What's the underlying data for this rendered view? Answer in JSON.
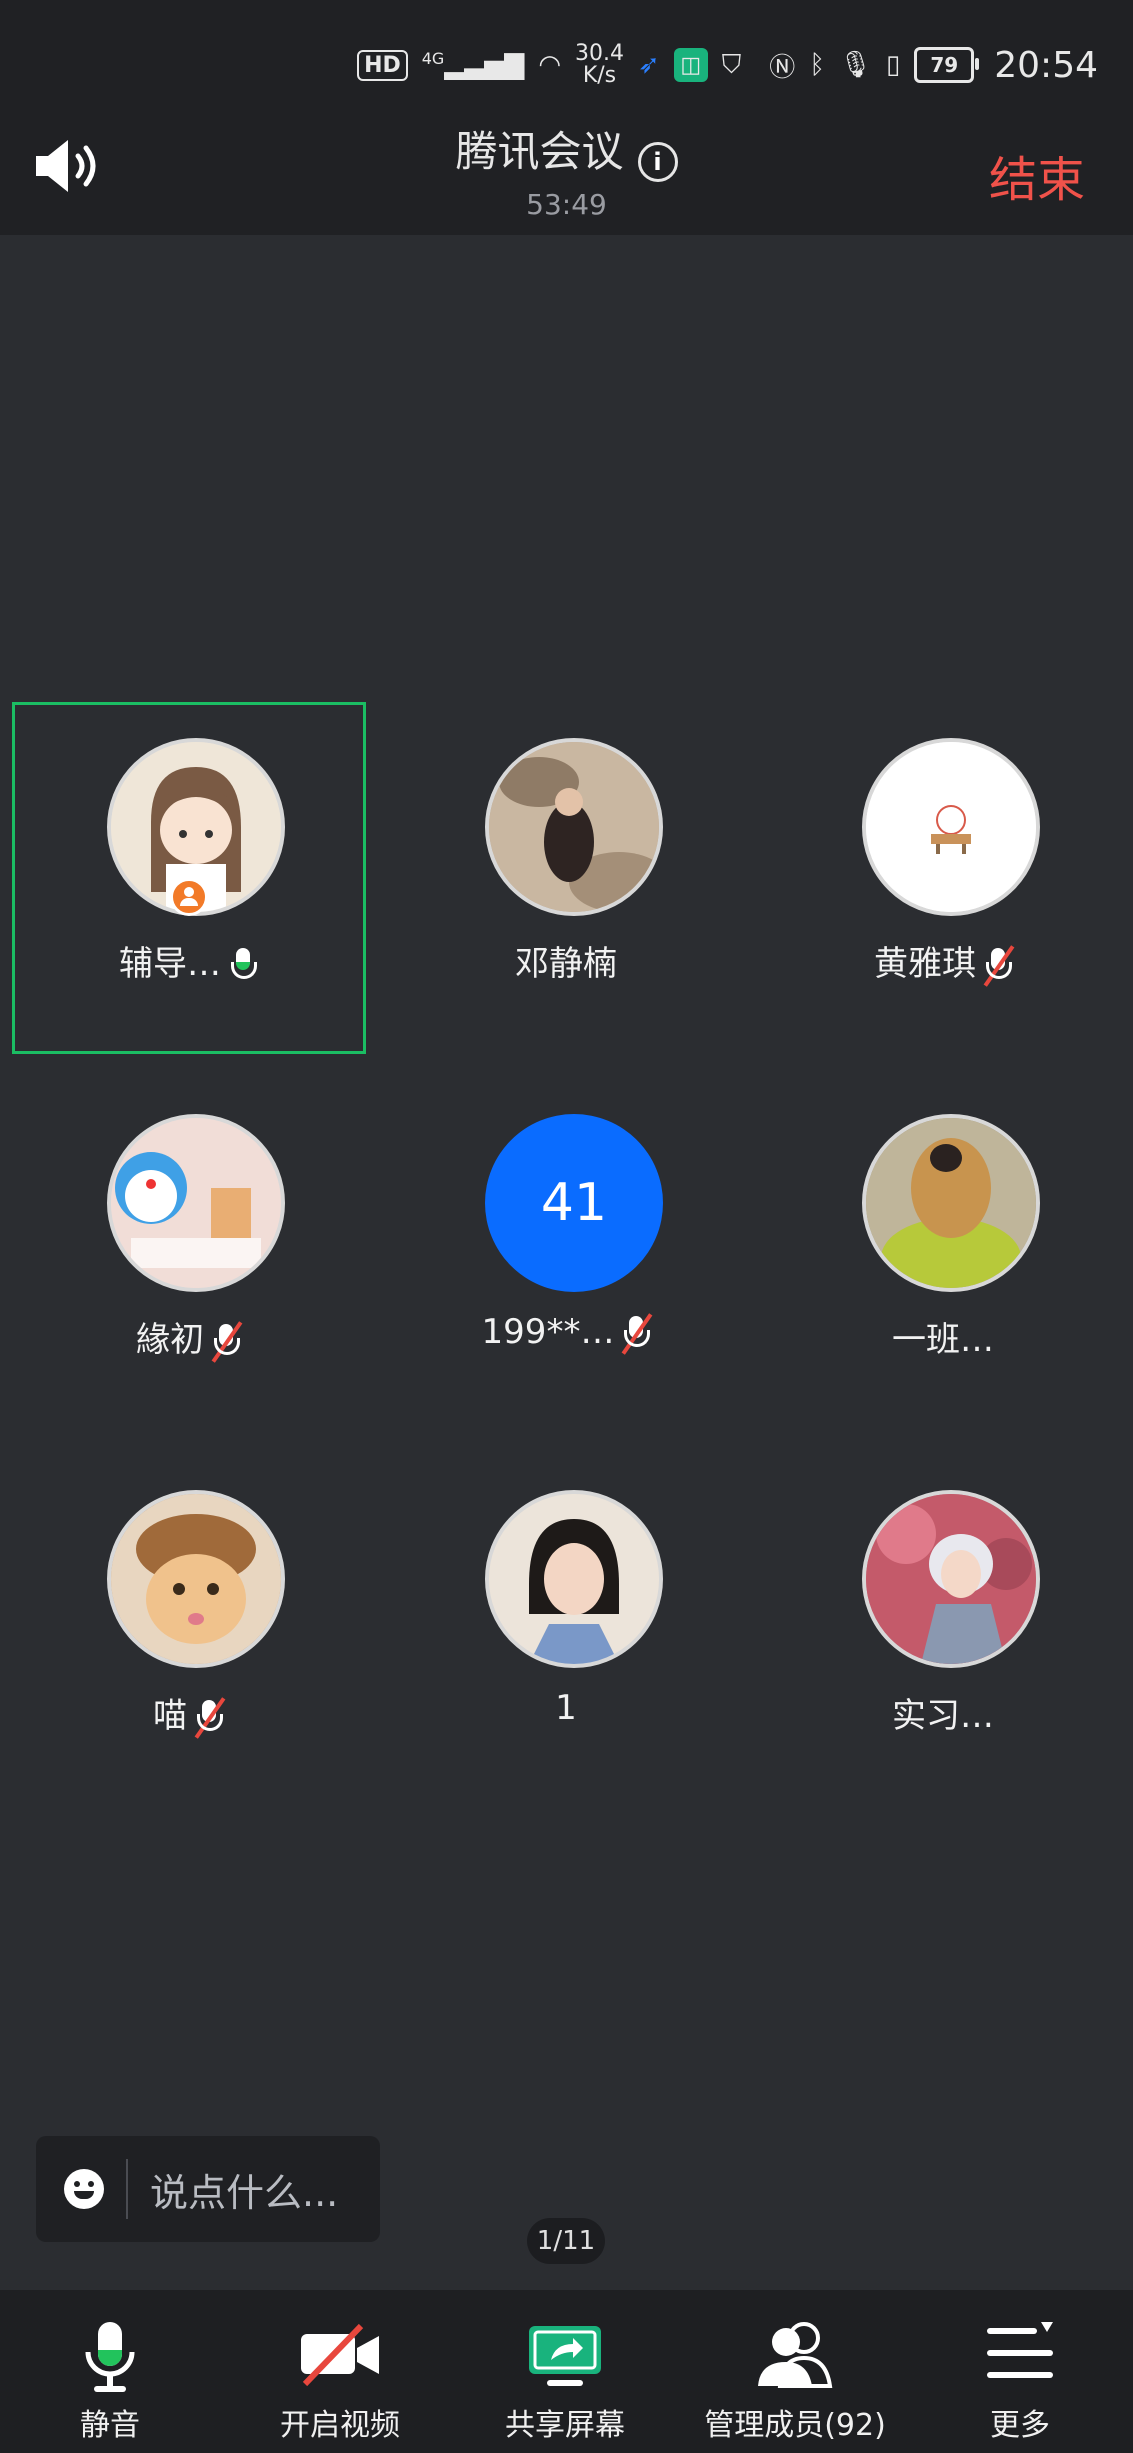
{
  "status_bar": {
    "hd": "HD",
    "signal": "4G",
    "net_speed_value": "30.4",
    "net_speed_unit": "K/s",
    "battery": "79",
    "time": "20:54"
  },
  "header": {
    "title": "腾讯会议",
    "timer": "53:49",
    "end_label": "结束"
  },
  "participants": [
    {
      "name": "辅导…",
      "mic": "on",
      "host": true,
      "active": true
    },
    {
      "name": "邓静楠",
      "mic": "none"
    },
    {
      "name": "黄雅琪",
      "mic": "off"
    },
    {
      "name": "緣初",
      "mic": "off"
    },
    {
      "name": "199**…",
      "mic": "off",
      "avatar_text": "41",
      "avatar_color": "#0a6cff"
    },
    {
      "name": "一班…",
      "mic": "none"
    },
    {
      "name": "喵",
      "mic": "off"
    },
    {
      "name": "1",
      "mic": "none"
    },
    {
      "name": "实习…",
      "mic": "none"
    }
  ],
  "chat": {
    "placeholder": "说点什么..."
  },
  "pager": "1/11",
  "toolbar": {
    "mute_label": "静音",
    "video_label": "开启视频",
    "share_label": "共享屏幕",
    "members_label": "管理成员(92)",
    "more_label": "更多"
  },
  "colors": {
    "accent_green": "#1bbd63",
    "end_red": "#f0524a",
    "host_orange": "#f27a28",
    "share_green": "#19b37d"
  }
}
